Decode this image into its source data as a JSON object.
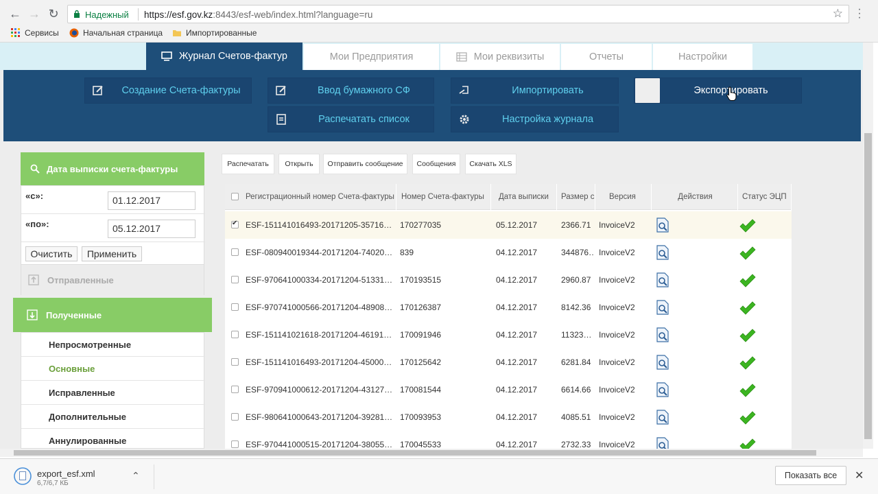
{
  "browser": {
    "secure_label": "Надежный",
    "url_host": "https://esf.gov.kz",
    "url_rest": ":8443/esf-web/index.html?language=ru",
    "bookmarks": [
      {
        "label": "Сервисы",
        "icon": "apps-icon"
      },
      {
        "label": "Начальная страница",
        "icon": "firefox-icon"
      },
      {
        "label": "Импортированные",
        "icon": "folder-icon"
      }
    ]
  },
  "app_tabs": [
    {
      "label": "Журнал Счетов-фактур",
      "icon": "monitor-icon",
      "active": true
    },
    {
      "label": "Мои Предприятия",
      "active": false
    },
    {
      "label": "Мои реквизиты",
      "icon": "grid-icon",
      "active": false
    },
    {
      "label": "Отчеты",
      "active": false
    },
    {
      "label": "Настройки",
      "active": false
    }
  ],
  "toolbar": {
    "create": "Создание Счета-фактуры",
    "paper": "Ввод бумажного СФ",
    "import": "Импортировать",
    "export": "Экспортировать",
    "print_list": "Распечатать список",
    "journal_settings": "Настройка журнала"
  },
  "filter": {
    "header": "Дата выписки счета-фактуры",
    "from_label": "«с»:",
    "from_value": "01.12.2017",
    "to_label": "«по»:",
    "to_value": "05.12.2017",
    "clear": "Очистить",
    "apply": "Применить"
  },
  "folders": {
    "sent": "Отправленные",
    "received": "Полученные",
    "sub": [
      "Непросмотренные",
      "Основные",
      "Исправленные",
      "Дополнительные",
      "Аннулированные"
    ],
    "selected_sub": "Основные"
  },
  "actions": [
    "Распечатать",
    "Открыть",
    "Отправить сообщение",
    "Сообщения",
    "Скачать XLS"
  ],
  "table": {
    "headers": [
      "Регистрационный номер Счета-фактуры",
      "Номер Счета-фактуры",
      "Дата выписки",
      "Размер с",
      "Версия",
      "Действия",
      "Статус ЭЦП"
    ],
    "rows": [
      {
        "reg": "ESF-151141016493-20171205-35716…",
        "num": "170277035",
        "date": "05.12.2017",
        "size": "2366.71",
        "ver": "InvoiceV2",
        "checked": true
      },
      {
        "reg": "ESF-080940019344-20171204-74020…",
        "num": "839",
        "date": "04.12.2017",
        "size": "344876…",
        "ver": "InvoiceV2",
        "checked": false
      },
      {
        "reg": "ESF-970641000334-20171204-51331…",
        "num": "170193515",
        "date": "04.12.2017",
        "size": "2960.87",
        "ver": "InvoiceV2",
        "checked": false
      },
      {
        "reg": "ESF-970741000566-20171204-48908…",
        "num": "170126387",
        "date": "04.12.2017",
        "size": "8142.36",
        "ver": "InvoiceV2",
        "checked": false
      },
      {
        "reg": "ESF-151141021618-20171204-46191…",
        "num": "170091946",
        "date": "04.12.2017",
        "size": "11323…",
        "ver": "InvoiceV2",
        "checked": false
      },
      {
        "reg": "ESF-151141016493-20171204-45000…",
        "num": "170125642",
        "date": "04.12.2017",
        "size": "6281.84",
        "ver": "InvoiceV2",
        "checked": false
      },
      {
        "reg": "ESF-970941000612-20171204-43127…",
        "num": "170081544",
        "date": "04.12.2017",
        "size": "6614.66",
        "ver": "InvoiceV2",
        "checked": false
      },
      {
        "reg": "ESF-980641000643-20171204-39281…",
        "num": "170093953",
        "date": "04.12.2017",
        "size": "4085.51",
        "ver": "InvoiceV2",
        "checked": false
      },
      {
        "reg": "ESF-970441000515-20171204-38055…",
        "num": "170045533",
        "date": "04.12.2017",
        "size": "2732.33",
        "ver": "InvoiceV2",
        "checked": false
      }
    ]
  },
  "download": {
    "file": "export_esf.xml",
    "size": "6,7/6,7 КБ",
    "show_all": "Показать все"
  },
  "colors": {
    "navy": "#1e4e79",
    "green": "#88cc66",
    "cyan": "#5fd0ee"
  }
}
